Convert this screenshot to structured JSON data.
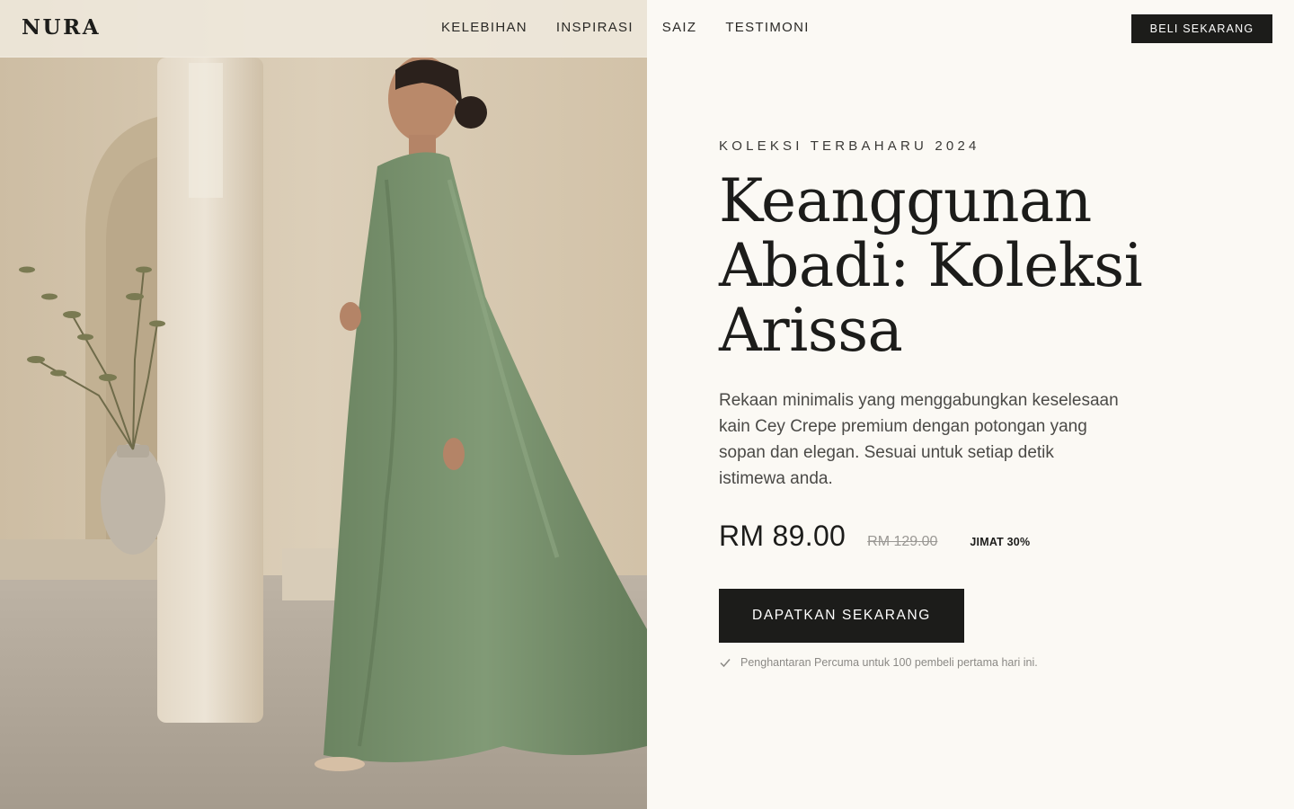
{
  "brand": {
    "logo": "NURA"
  },
  "nav": {
    "items": [
      {
        "label": "KELEBIHAN"
      },
      {
        "label": "INSPIRASI"
      },
      {
        "label": "SAIZ"
      },
      {
        "label": "TESTIMONI"
      }
    ],
    "cta_label": "BELI SEKARANG"
  },
  "hero": {
    "image_icon": "model-photo",
    "eyebrow": "KOLEKSI TERBAHARU 2024",
    "title_lines": [
      "Keanggunan",
      "Abadi: Koleksi",
      "Arissa"
    ],
    "description": "Rekaan minimalis yang menggabungkan keselesaan kain Cey Crepe premium dengan potongan yang sopan dan elegan. Sesuai untuk setiap detik istimewa anda.",
    "price": "RM 89.00",
    "old_price": "RM 129.00",
    "discount": "JIMAT 30%",
    "cta_label": "DAPATKAN SEKARANG",
    "note_icon": "check-icon",
    "note": "Penghantaran Percuma untuk 100 pembeli pertama hari ini."
  },
  "colors": {
    "accent": "#1c1c1a",
    "background": "#fbf9f4",
    "dress": "#7b9471"
  }
}
